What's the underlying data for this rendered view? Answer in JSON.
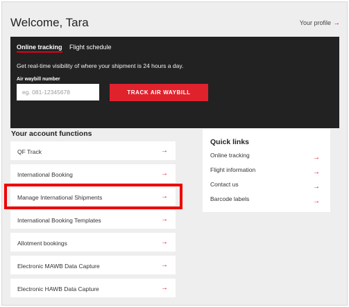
{
  "header": {
    "welcome": "Welcome, Tara",
    "profile_link": "Your profile",
    "arrow_icon": "→"
  },
  "tracking": {
    "tabs": [
      {
        "label": "Online tracking",
        "active": true
      },
      {
        "label": "Flight schedule",
        "active": false
      }
    ],
    "description": "Get real-time visibility of where your shipment is 24 hours a day.",
    "field_label": "Air waybill number",
    "input_placeholder": "eg. 081-12345678",
    "input_value": "",
    "button_label": "TRACK AIR WAYBILL"
  },
  "account_functions": {
    "title": "Your account functions",
    "items": [
      {
        "label": "QF Track"
      },
      {
        "label": "International Booking"
      },
      {
        "label": "Manage International Shipments",
        "highlighted": true
      },
      {
        "label": "International Booking Templates"
      },
      {
        "label": "Allotment bookings"
      },
      {
        "label": "Electronic MAWB Data Capture"
      },
      {
        "label": "Electronic HAWB Data Capture"
      }
    ]
  },
  "quick_links": {
    "title": "Quick links",
    "items": [
      {
        "label": "Online tracking"
      },
      {
        "label": "Flight information"
      },
      {
        "label": "Contact us"
      },
      {
        "label": "Barcode labels"
      }
    ]
  },
  "colors": {
    "accent": "#e0001b",
    "button": "#e0222d",
    "dark_panel": "#222222",
    "background": "#eeeeee",
    "highlight_box": "#ee0000"
  }
}
